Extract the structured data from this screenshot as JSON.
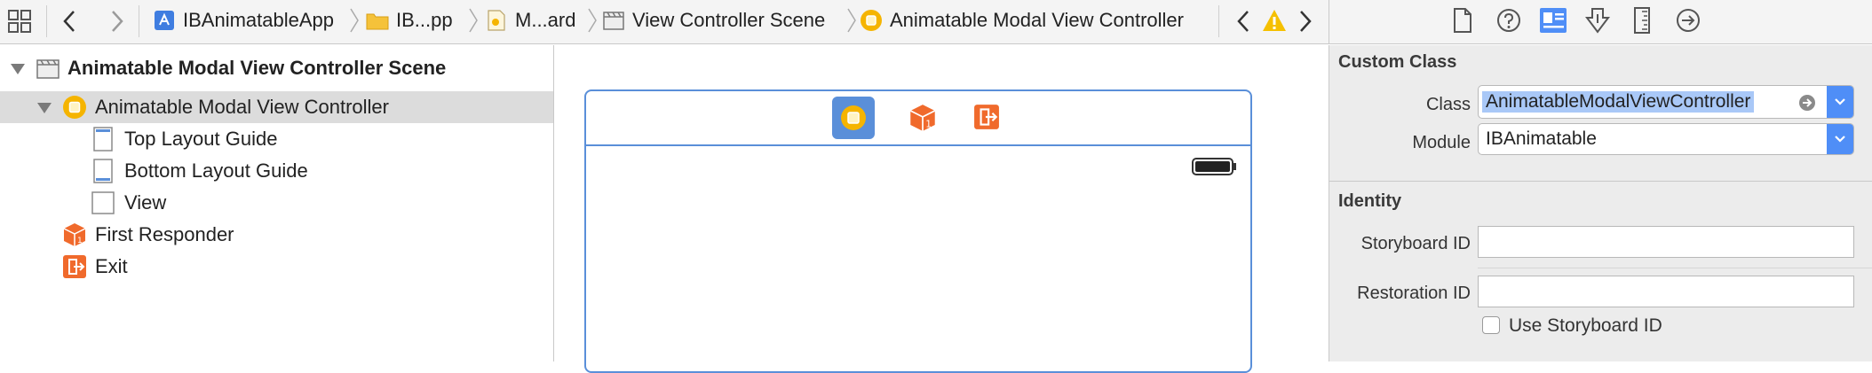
{
  "jumpbar": {
    "breadcrumbs": [
      {
        "label": "IBAnimatableApp",
        "icon": "xcode-project-icon"
      },
      {
        "label": "IB...pp",
        "icon": "folder-icon"
      },
      {
        "label": "M...ard",
        "icon": "storyboard-file-icon"
      },
      {
        "label": "View Controller Scene",
        "icon": "scene-icon"
      },
      {
        "label": "Animatable Modal View Controller",
        "icon": "view-controller-icon"
      }
    ]
  },
  "outline": {
    "scene_label": "Animatable Modal View Controller Scene",
    "items": [
      {
        "label": "Animatable Modal View Controller",
        "icon": "view-controller-icon",
        "selected": true
      },
      {
        "label": "Top Layout Guide",
        "icon": "layout-guide-icon"
      },
      {
        "label": "Bottom Layout Guide",
        "icon": "layout-guide-icon"
      },
      {
        "label": "View",
        "icon": "view-icon"
      },
      {
        "label": "First Responder",
        "icon": "first-responder-icon"
      },
      {
        "label": "Exit",
        "icon": "exit-icon"
      }
    ]
  },
  "inspector": {
    "tabs": [
      "file-inspector-icon",
      "quick-help-icon",
      "identity-inspector-icon",
      "attributes-inspector-icon",
      "size-inspector-icon",
      "connections-inspector-icon"
    ],
    "active_tab": "identity-inspector-icon",
    "custom_class": {
      "title": "Custom Class",
      "class_label": "Class",
      "class_value": "AnimatableModalViewController",
      "module_label": "Module",
      "module_value": "IBAnimatable"
    },
    "identity": {
      "title": "Identity",
      "storyboard_id_label": "Storyboard ID",
      "storyboard_id_value": "",
      "restoration_id_label": "Restoration ID",
      "restoration_id_value": "",
      "use_storyboard_id_label": "Use Storyboard ID",
      "use_storyboard_id_checked": false
    }
  },
  "colors": {
    "accent_blue": "#4f8ef7",
    "selection_gray": "#dcdcdc",
    "vc_yellow": "#f5b400",
    "responder_orange": "#f06a2c",
    "frame_blue": "#5a8fd9"
  }
}
